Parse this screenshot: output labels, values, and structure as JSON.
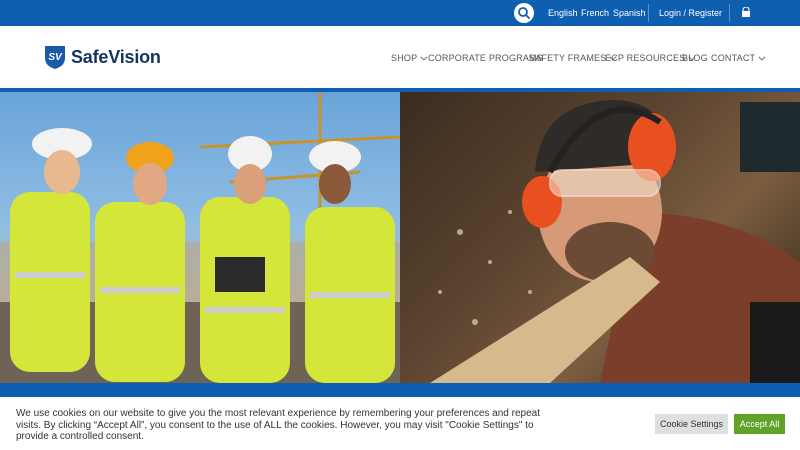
{
  "topbar": {
    "languages": [
      "English",
      "French",
      "Spanish"
    ],
    "account_label": "Login / Register",
    "search_icon": "search-icon",
    "cart_icon": "shopping-bag-icon"
  },
  "brand": {
    "logo_mark": "SV",
    "name": "SafeVision",
    "color": "#16345c"
  },
  "nav": {
    "items": [
      {
        "label": "SHOP",
        "has_dropdown": true
      },
      {
        "label": "CORPORATE PROGRAMS",
        "has_dropdown": false
      },
      {
        "label": "SAFETY FRAMES",
        "has_dropdown": true
      },
      {
        "label": "ECP RESOURCES",
        "has_dropdown": true
      },
      {
        "label": "BLOG",
        "has_dropdown": false
      },
      {
        "label": "CONTACT",
        "has_dropdown": true
      }
    ]
  },
  "hero": {
    "left_image": "construction-workers-hardhats",
    "right_image": "woodworker-safety-glasses"
  },
  "cookie": {
    "text": "We use cookies on our website to give you the most relevant experience by remembering your preferences and repeat visits. By clicking “Accept All”, you consent to the use of ALL the cookies. However, you may visit \"Cookie Settings\" to provide a controlled consent.",
    "settings_label": "Cookie Settings",
    "accept_label": "Accept All"
  },
  "colors": {
    "primary": "#0f5fb0",
    "accept": "#61a229",
    "settings_bg": "#dedfe0"
  }
}
